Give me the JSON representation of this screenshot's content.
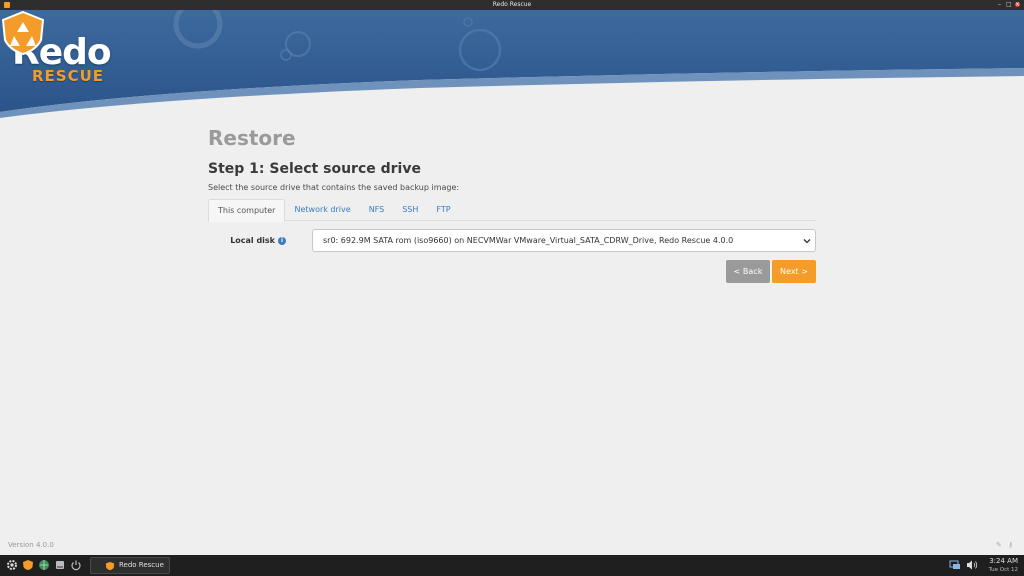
{
  "window": {
    "title": "Redo Rescue"
  },
  "logo": {
    "name": "Redo",
    "subtitle": "RESCUE"
  },
  "page": {
    "title": "Restore",
    "step_title": "Step 1: Select source drive",
    "instruction": "Select the source drive that contains the saved backup image:"
  },
  "tabs": [
    {
      "label": "This computer",
      "active": true
    },
    {
      "label": "Network drive",
      "active": false
    },
    {
      "label": "NFS",
      "active": false
    },
    {
      "label": "SSH",
      "active": false
    },
    {
      "label": "FTP",
      "active": false
    }
  ],
  "local_disk": {
    "label": "Local disk",
    "selected": "sr0: 692.9M SATA rom (iso9660) on NECVMWar VMware_Virtual_SATA_CDRW_Drive, Redo Rescue 4.0.0"
  },
  "buttons": {
    "back": "< Back",
    "next": "Next >"
  },
  "footer": {
    "version": "Version 4.0.0"
  },
  "taskbar": {
    "app_label": "Redo Rescue",
    "time": "3:24 AM",
    "date": "Tue Oct 12"
  },
  "colors": {
    "header_blue": "#2d5a8c",
    "accent_orange": "#f39c2a",
    "link_blue": "#3a7cc0",
    "back_gray": "#9a9a9a"
  }
}
